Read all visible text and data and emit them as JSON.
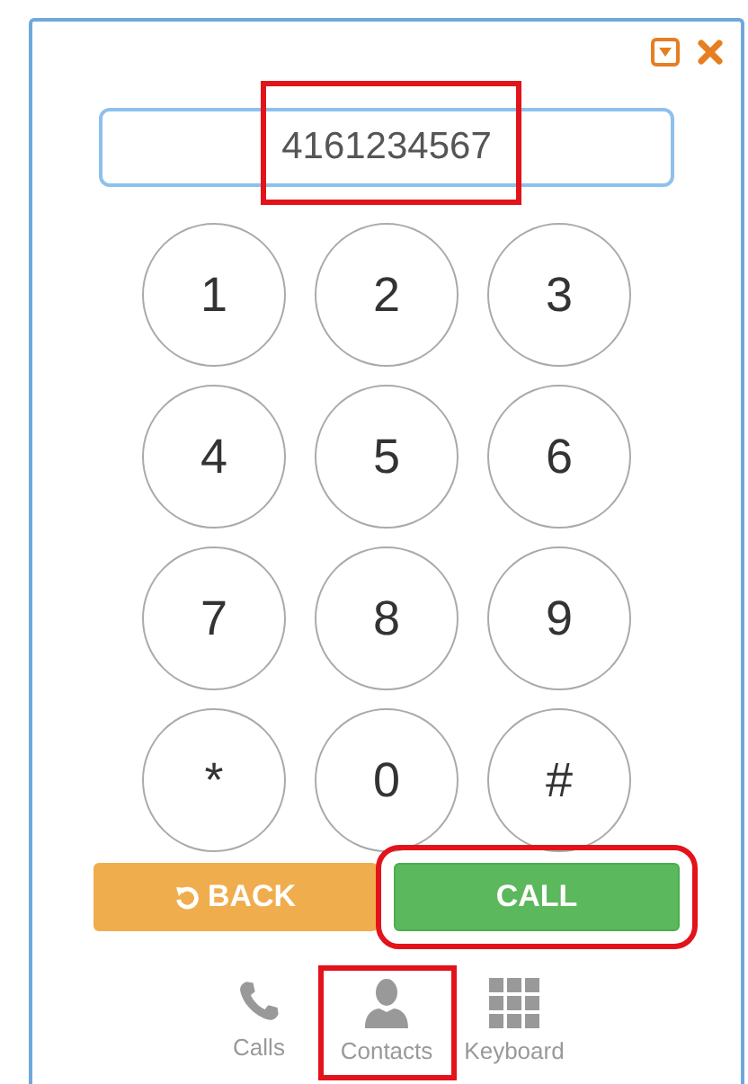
{
  "dial_field": {
    "value": "4161234567",
    "highlighted": true
  },
  "keypad": [
    {
      "label": "1"
    },
    {
      "label": "2"
    },
    {
      "label": "3"
    },
    {
      "label": "4"
    },
    {
      "label": "5"
    },
    {
      "label": "6"
    },
    {
      "label": "7"
    },
    {
      "label": "8"
    },
    {
      "label": "9"
    },
    {
      "label": "*"
    },
    {
      "label": "0"
    },
    {
      "label": "#"
    }
  ],
  "buttons": [
    {
      "kind": "back",
      "label": "BACK",
      "highlighted": false
    },
    {
      "kind": "call",
      "label": "CALL",
      "highlighted": true
    }
  ],
  "tabs": [
    {
      "kind": "calls",
      "label": "Calls",
      "highlighted": false
    },
    {
      "kind": "contacts",
      "label": "Contacts",
      "highlighted": true
    },
    {
      "kind": "keyboard",
      "label": "Keyboard",
      "highlighted": false
    }
  ]
}
